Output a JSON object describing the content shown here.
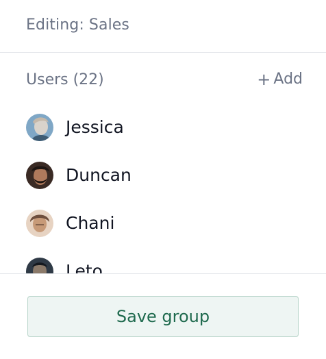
{
  "header": {
    "title": "Editing: Sales"
  },
  "users": {
    "title": "Users (22)",
    "add_label": "Add",
    "items": [
      {
        "name": "Jessica",
        "avatar_colors": [
          "#7fa7c6",
          "#d9d3cb",
          "#3d5b73"
        ]
      },
      {
        "name": "Duncan",
        "avatar_colors": [
          "#3a2a24",
          "#b07a5c",
          "#1d1512"
        ]
      },
      {
        "name": "Chani",
        "avatar_colors": [
          "#c79a78",
          "#6f4f3d",
          "#e7d3c2"
        ]
      },
      {
        "name": "Leto",
        "avatar_colors": [
          "#2f3a46",
          "#8b7a6a",
          "#15191f"
        ]
      }
    ]
  },
  "footer": {
    "save_label": "Save group"
  },
  "colors": {
    "accent": "#1f6a4e",
    "muted_text": "#6b7385",
    "border": "#e3e6ea"
  }
}
